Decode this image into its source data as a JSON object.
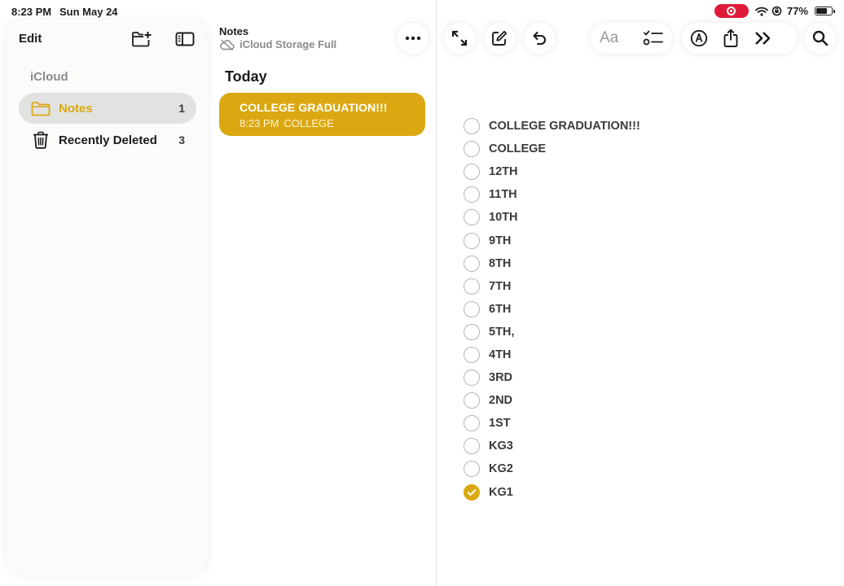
{
  "status_bar": {
    "time": "8:23 PM",
    "date": "Sun May 24",
    "battery_percent": "77%",
    "battery_level": 0.77
  },
  "sidebar": {
    "edit_label": "Edit",
    "section_title": "iCloud",
    "folders": [
      {
        "name": "Notes",
        "count": "1",
        "selected": true,
        "icon": "folder-icon"
      },
      {
        "name": "Recently Deleted",
        "count": "3",
        "selected": false,
        "icon": "trash-icon"
      }
    ]
  },
  "list": {
    "title": "Notes",
    "subtitle": "iCloud Storage Full",
    "section": "Today",
    "notes": [
      {
        "title": "COLLEGE GRADUATION!!!",
        "time": "8:23 PM",
        "preview": "COLLEGE"
      }
    ]
  },
  "toolbar": {
    "icons": [
      "more-icon",
      "expand-icon",
      "compose-icon",
      "undo-icon",
      "format-icon",
      "checklist-icon",
      "markup-icon",
      "share-icon",
      "more-tools-icon",
      "search-icon"
    ],
    "format_label": "Aa"
  },
  "checklist": [
    {
      "text": "COLLEGE GRADUATION!!!",
      "checked": false
    },
    {
      "text": "COLLEGE",
      "checked": false
    },
    {
      "text": "12TH",
      "checked": false
    },
    {
      "text": "11TH",
      "checked": false
    },
    {
      "text": "10TH",
      "checked": false
    },
    {
      "text": "9TH",
      "checked": false
    },
    {
      "text": "8TH",
      "checked": false
    },
    {
      "text": "7TH",
      "checked": false
    },
    {
      "text": "6TH",
      "checked": false
    },
    {
      "text": "5TH,",
      "checked": false
    },
    {
      "text": "4TH",
      "checked": false
    },
    {
      "text": "3RD",
      "checked": false
    },
    {
      "text": "2ND",
      "checked": false
    },
    {
      "text": "1ST",
      "checked": false
    },
    {
      "text": "KG3",
      "checked": false
    },
    {
      "text": "KG2",
      "checked": false
    },
    {
      "text": "KG1",
      "checked": true
    }
  ],
  "colors": {
    "accent": "#dba811",
    "recording": "#e01b3a",
    "sidebar_bg": "#fbfbfa",
    "selected_row": "#e2e2e0"
  }
}
